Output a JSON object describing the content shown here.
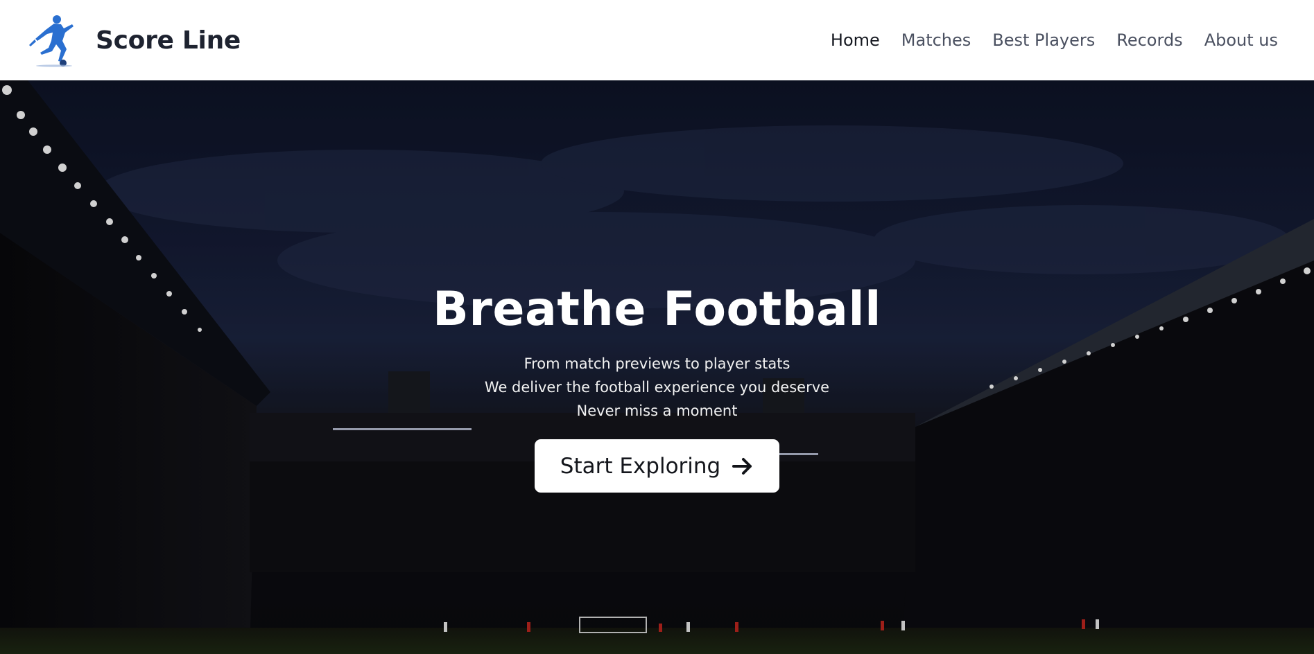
{
  "brand": {
    "name": "Score Line",
    "logo_icon": "football-player-kicking-icon",
    "logo_color": "#2a6fd0"
  },
  "nav": {
    "items": [
      {
        "label": "Home",
        "active": true
      },
      {
        "label": "Matches",
        "active": false
      },
      {
        "label": "Best Players",
        "active": false
      },
      {
        "label": "Records",
        "active": false
      },
      {
        "label": "About us",
        "active": false
      }
    ]
  },
  "hero": {
    "title": "Breathe Football",
    "lines": [
      "From match previews to player stats",
      "We deliver the football experience you deserve",
      "Never miss a moment"
    ],
    "cta": {
      "label": "Start Exploring",
      "icon": "arrow-right-icon"
    },
    "background_description_icon": "stadium-night-image"
  },
  "colors": {
    "header_bg": "#ffffff",
    "hero_sky": "#1c2541",
    "text_dark": "#1e2330",
    "nav_text": "#4a5060",
    "cta_bg": "#ffffff"
  }
}
